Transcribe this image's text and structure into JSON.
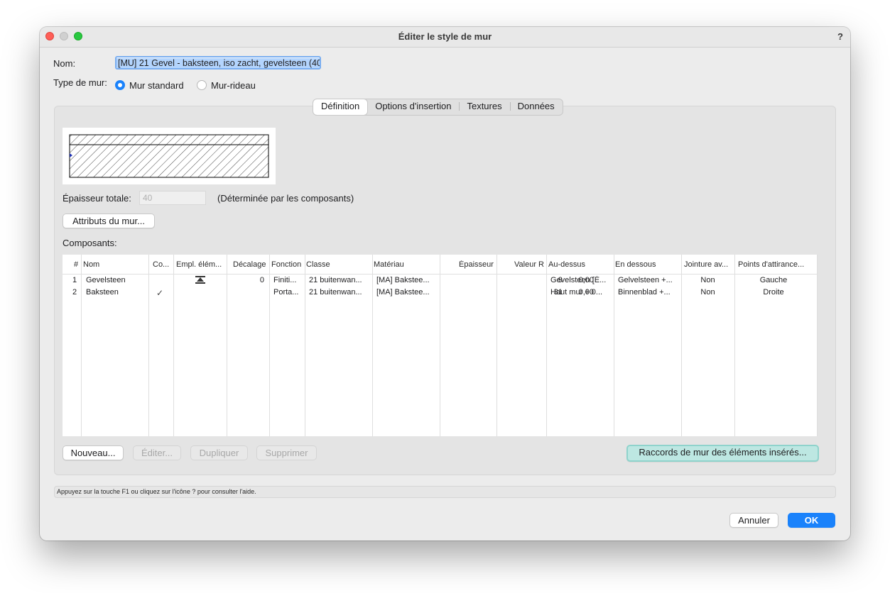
{
  "window": {
    "title": "Éditer le style de mur",
    "help": "?"
  },
  "form": {
    "name_label": "Nom:",
    "name_value": "[MU] 21 Gevel - baksteen, iso zacht, gevelsteen (40",
    "type_label": "Type de mur:",
    "type_options": [
      {
        "label": "Mur standard",
        "selected": true
      },
      {
        "label": "Mur-rideau",
        "selected": false
      }
    ]
  },
  "tabs": [
    {
      "label": "Définition",
      "selected": true
    },
    {
      "label": "Options d'insertion",
      "selected": false
    },
    {
      "label": "Textures",
      "selected": false
    },
    {
      "label": "Données",
      "selected": false
    }
  ],
  "definition": {
    "thickness_label": "Épaisseur totale:",
    "thickness_value": "40",
    "thickness_note": "(Déterminée par les composants)",
    "wall_attributes_button": "Attributs du mur...",
    "components_label": "Composants:"
  },
  "table": {
    "columns": [
      "#",
      "Nom",
      "Co...",
      "Empl. élém...",
      "Décalage",
      "Fonction",
      "Classe",
      "Matériau",
      "Épaisseur",
      "Valeur R",
      "Au-dessus",
      "En dessous",
      "Jointure av...",
      "Points d'attirance..."
    ],
    "rows": [
      {
        "num": "1",
        "nom": "Gevelsteen",
        "co": "",
        "empl": "insert-icon",
        "decalage": "0",
        "fonction": "Finiti...",
        "classe": "21 buitenwan...",
        "materiau": "[MA] Bakstee...",
        "epaisseur": "9",
        "valeur_r": "0,00",
        "au_dessus": "Gevelsteen [É...",
        "en_dessous": "Gelvelsteen +...",
        "jointure": "Non",
        "points": "Gauche"
      },
      {
        "num": "2",
        "nom": "Baksteen",
        "co": "✓",
        "empl": "",
        "decalage": "",
        "fonction": "Porta...",
        "classe": "21 buitenwan...",
        "materiau": "[MA] Bakstee...",
        "epaisseur": "31",
        "valeur_r": "0,00",
        "au_dessus": "Haut mur + 0...",
        "en_dessous": "Binnenblad +...",
        "jointure": "Non",
        "points": "Droite"
      }
    ]
  },
  "buttons": {
    "new": "Nouveau...",
    "edit": "Éditer...",
    "duplicate": "Dupliquer",
    "delete": "Supprimer",
    "wall_joints": "Raccords de mur des éléments insérés...",
    "cancel": "Annuler",
    "ok": "OK"
  },
  "status": "Appuyez sur la touche F1 ou cliquez sur l'icône ? pour consulter l'aide.",
  "colors": {
    "accent": "#1a82fb",
    "highlight_button": "#bde7e2"
  }
}
